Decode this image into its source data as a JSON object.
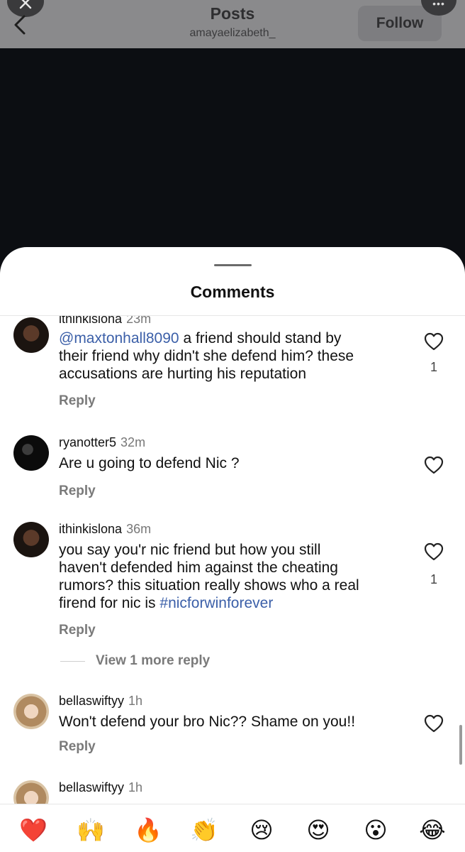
{
  "header": {
    "title": "Posts",
    "subtitle": "amayaelizabeth_",
    "follow_label": "Follow",
    "more_label": "•••"
  },
  "sheet": {
    "title": "Comments"
  },
  "comments": [
    {
      "username": "ithinkislona",
      "time": "23m",
      "mention": "@maxtonhall8090",
      "text_lines": [
        "a friend should stand by",
        "their friend why didn't she defend him? these",
        "accusations are hurting his reputation"
      ],
      "reply_label": "Reply",
      "likes": "1"
    },
    {
      "username": "ryanotter5",
      "time": "32m",
      "text": "Are u going to defend Nic ?",
      "reply_label": "Reply"
    },
    {
      "username": "ithinkislona",
      "time": "36m",
      "text_lines": [
        "you say you'r nic friend but how you still",
        "haven't defended him against the cheating",
        "rumors? this situation really shows who a real",
        "firend for nic is"
      ],
      "hashtag": "#nicforwinforever",
      "reply_label": "Reply",
      "likes": "1",
      "view_more_label": "View 1 more reply"
    },
    {
      "username": "bellaswiftyy",
      "time": "1h",
      "text": "Won't defend your bro Nic?? Shame on you!!",
      "reply_label": "Reply"
    },
    {
      "username": "bellaswiftyy",
      "time": "1h"
    }
  ],
  "emoji_bar": [
    "❤️",
    "🙌",
    "🔥",
    "👏",
    "😢",
    "😍",
    "😮",
    "😂"
  ],
  "icons": {
    "close": "close-icon",
    "back": "back-arrow-icon",
    "heart": "heart-outline-icon",
    "more": "more-icon"
  }
}
